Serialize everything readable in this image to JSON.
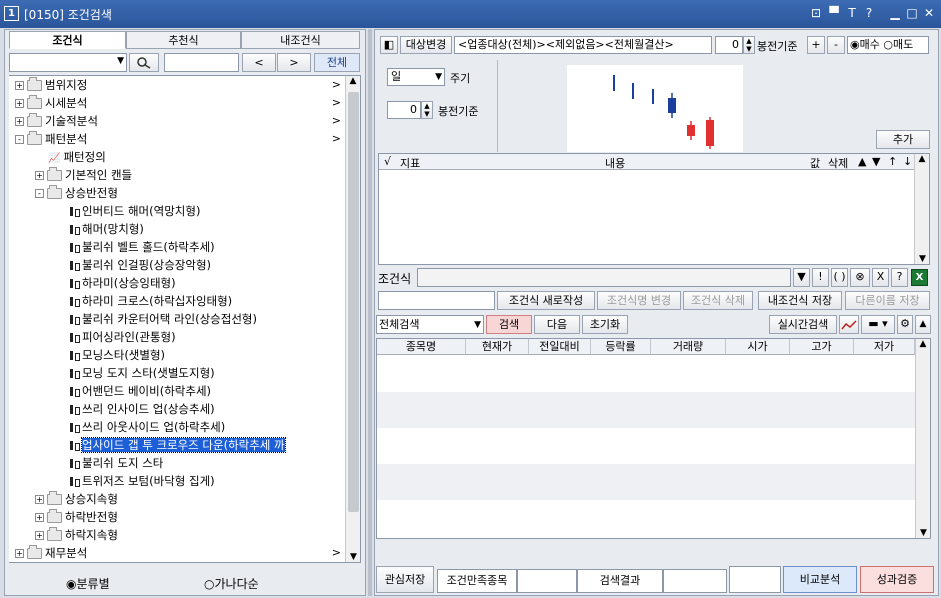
{
  "window": {
    "screen_no": "1",
    "title": "[0150] 조건검색",
    "controls": [
      "⊡",
      "▀",
      "T",
      "?",
      "▁",
      "□",
      "✕"
    ]
  },
  "left": {
    "tabs": [
      "조건식",
      "추천식",
      "내조건식"
    ],
    "search": {
      "value": "",
      "prev": "<",
      "next": ">",
      "all": "전체"
    },
    "tree": [
      {
        "level": 0,
        "exp": "+",
        "label": "범위지정",
        "type": "folder",
        "arrow": ">"
      },
      {
        "level": 0,
        "exp": "+",
        "label": "시세분석",
        "type": "folder",
        "arrow": ">"
      },
      {
        "level": 0,
        "exp": "+",
        "label": "기술적분석",
        "type": "folder",
        "arrow": ">"
      },
      {
        "level": 0,
        "exp": "-",
        "label": "패턴분석",
        "type": "folder",
        "arrow": ">"
      },
      {
        "level": 1,
        "exp": "",
        "label": "패턴정의",
        "type": "chart"
      },
      {
        "level": 1,
        "exp": "+",
        "label": "기본적인 캔들",
        "type": "folder"
      },
      {
        "level": 1,
        "exp": "-",
        "label": "상승반전형",
        "type": "folder"
      },
      {
        "level": 2,
        "exp": "",
        "label": "인버티드 해머(역망치형)",
        "type": "candle"
      },
      {
        "level": 2,
        "exp": "",
        "label": "해머(망치형)",
        "type": "candle"
      },
      {
        "level": 2,
        "exp": "",
        "label": "불리쉬 벨트 홀드(하락추세)",
        "type": "candle"
      },
      {
        "level": 2,
        "exp": "",
        "label": "불리쉬 인걸핑(상승장악형)",
        "type": "candle"
      },
      {
        "level": 2,
        "exp": "",
        "label": "하라미(상승잉태형)",
        "type": "candle"
      },
      {
        "level": 2,
        "exp": "",
        "label": "하라미 크로스(하락십자잉태형)",
        "type": "candle"
      },
      {
        "level": 2,
        "exp": "",
        "label": "불리쉬 카운터어택 라인(상승접선형)",
        "type": "candle"
      },
      {
        "level": 2,
        "exp": "",
        "label": "피어싱라인(관통형)",
        "type": "candle"
      },
      {
        "level": 2,
        "exp": "",
        "label": "모닝스타(샛별형)",
        "type": "candle"
      },
      {
        "level": 2,
        "exp": "",
        "label": "모닝 도지 스타(샛별도지형)",
        "type": "candle"
      },
      {
        "level": 2,
        "exp": "",
        "label": "어밴던드 베이비(하락추세)",
        "type": "candle"
      },
      {
        "level": 2,
        "exp": "",
        "label": "쓰리 인사이드 업(상승추세)",
        "type": "candle"
      },
      {
        "level": 2,
        "exp": "",
        "label": "쓰리 아웃사이드 업(하락추세)",
        "type": "candle"
      },
      {
        "level": 2,
        "exp": "",
        "label": "업사이드 갭 투 크로우즈 다운(하락추세 까",
        "type": "candle",
        "selected": true
      },
      {
        "level": 2,
        "exp": "",
        "label": "불리쉬 도지 스타",
        "type": "candle"
      },
      {
        "level": 2,
        "exp": "",
        "label": "트위저즈 보텀(바닥형 집게)",
        "type": "candle"
      },
      {
        "level": 1,
        "exp": "+",
        "label": "상승지속형",
        "type": "folder"
      },
      {
        "level": 1,
        "exp": "+",
        "label": "하락반전형",
        "type": "folder"
      },
      {
        "level": 1,
        "exp": "+",
        "label": "하락지속형",
        "type": "folder"
      },
      {
        "level": 0,
        "exp": "+",
        "label": "재무분석",
        "type": "folder",
        "arrow": ">"
      }
    ],
    "radio": {
      "opt1": "분류별",
      "opt2": "가나다순",
      "selected": "분류별"
    }
  },
  "right": {
    "toolbar": {
      "target_btn": "대상변경",
      "target_text": "<업종대상(전체)><제외없음><전체월결산>",
      "bong_value": "0",
      "bong_label": "봉전기준",
      "plus": "+",
      "minus": "-",
      "buy": "매수",
      "sell": "매도",
      "trade_selected": "매수"
    },
    "period": {
      "value": "일",
      "label": "주기",
      "bong_value": "0",
      "bong_label": "봉전기준"
    },
    "add_btn": "추가",
    "cond_table": {
      "headers": [
        "√",
        "지표",
        "내용",
        "값",
        "삭제"
      ],
      "sort_icons": [
        "▲",
        "▼",
        "↑",
        "↓"
      ]
    },
    "cond": {
      "label": "조건식",
      "buttons": [
        "▼",
        "!",
        "( )",
        "⊗",
        "X",
        "?"
      ]
    },
    "actions": {
      "new": "조건식 새로작성",
      "rename": "조건식명 변경",
      "delete": "조건식 삭제",
      "save": "내조건식 저장",
      "save_as": "다른이름 저장"
    },
    "search_bar": {
      "scope": "전체검색",
      "search": "검색",
      "next": "다음",
      "reset": "초기화",
      "realtime": "실시간검색"
    },
    "result_headers": [
      "종목명",
      "현재가",
      "전일대비",
      "등락률",
      "거래량",
      "시가",
      "고가",
      "저가"
    ],
    "bottom": {
      "fav_save": "관심저장",
      "matched": "조건만족종목",
      "result": "검색결과",
      "compare": "비교분석",
      "verify": "성과검증"
    },
    "colors": {
      "bull": "#e03030",
      "bear": "#1c3f9e",
      "accent": "#2a559a"
    }
  }
}
